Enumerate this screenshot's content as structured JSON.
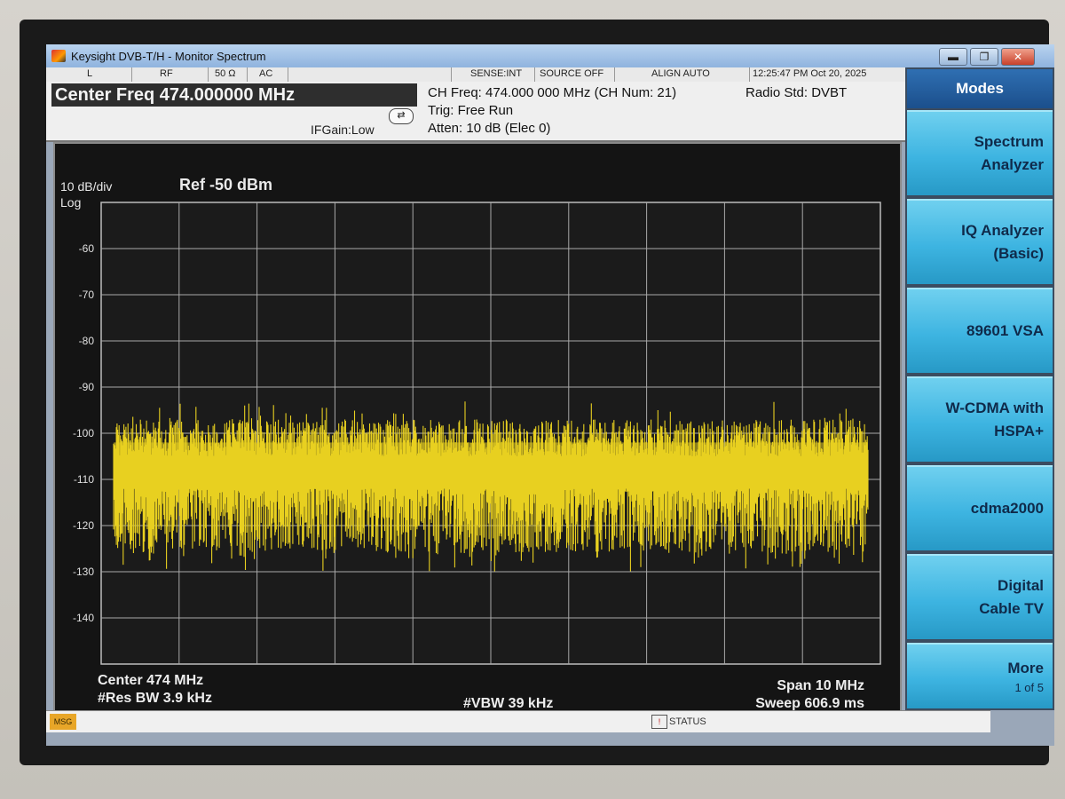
{
  "window": {
    "title": "Keysight DVB-T/H - Monitor Spectrum",
    "controls": {
      "minimize": "▬",
      "restore": "❐",
      "close": "✕"
    }
  },
  "status_strip": {
    "items": [
      "L",
      "RF",
      "50 Ω",
      "AC",
      "SENSE:INT",
      "SOURCE OFF",
      "ALIGN AUTO",
      "12:25:47 PM Oct 20, 2025"
    ]
  },
  "info": {
    "center_freq": "Center Freq 474.000000 MHz",
    "ifgain": "IFGain:Low",
    "ch_freq": "CH Freq: 474.000 000 MHz (CH Num: 21)",
    "radio_std": "Radio Std: DVBT",
    "trig": "Trig: Free Run",
    "atten": "Atten: 10 dB (Elec 0)"
  },
  "display": {
    "scale_div": "10 dB/div",
    "scale_type": "Log",
    "ref": "Ref  -50 dBm",
    "center": "Center  474 MHz",
    "res_bw": "#Res BW  3.9 kHz",
    "vbw": "#VBW  39 kHz",
    "span": "Span 10 MHz",
    "sweep": "Sweep  606.9 ms",
    "trace_color": "#e8d020"
  },
  "chart_data": {
    "type": "line",
    "x_range": [
      469,
      479
    ],
    "x_unit": "MHz",
    "y_ticks": [
      -60,
      -70,
      -80,
      -90,
      -100,
      -110,
      -120,
      -130,
      -140
    ],
    "ylim": [
      -150,
      -50
    ],
    "grid": true,
    "noise_floor": {
      "peak_envelope_dbm": -97,
      "min_envelope_dbm": -120,
      "deep_dip_dbm": -130
    }
  },
  "softkeys": {
    "header": "Modes",
    "items": [
      {
        "label": "Spectrum",
        "label2": "Analyzer"
      },
      {
        "label": "IQ Analyzer",
        "label2": "(Basic)"
      },
      {
        "label": "89601 VSA",
        "label2": ""
      },
      {
        "label": "W-CDMA with",
        "label2": "HSPA+"
      },
      {
        "label": "cdma2000",
        "label2": ""
      },
      {
        "label": "Digital",
        "label2": "Cable TV"
      },
      {
        "label": "More",
        "sub": "1 of 5"
      }
    ]
  },
  "msgbar": {
    "badge": "MSG",
    "status": "STATUS"
  }
}
